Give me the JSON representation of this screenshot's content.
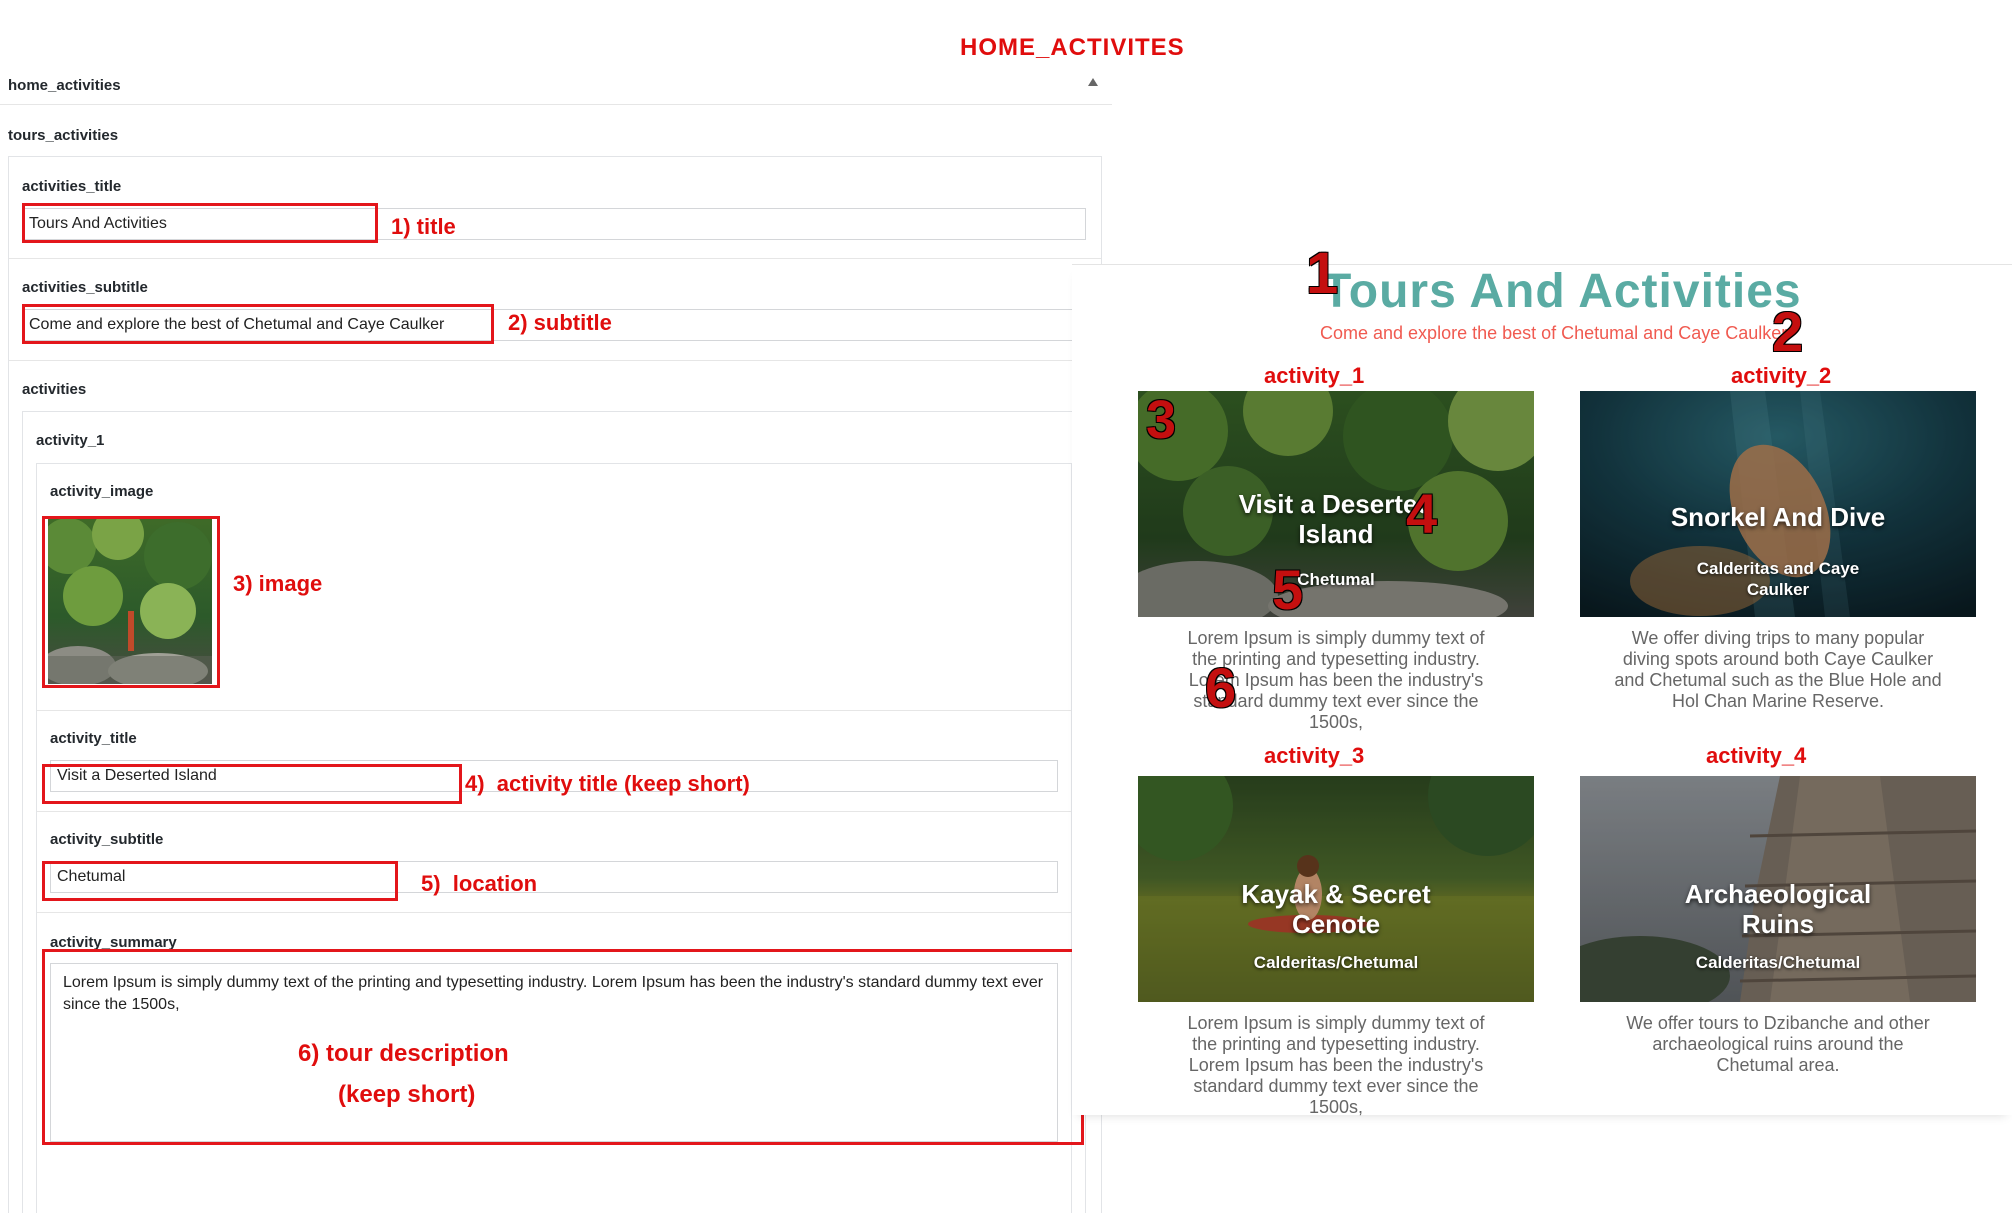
{
  "header": {
    "title": "HOME_ACTIVITES"
  },
  "admin": {
    "section_label": "home_activities",
    "collapse_icon": "triangle-up-icon",
    "group_label": "tours_activities",
    "activities_title_label": "activities_title",
    "activities_title_value": "Tours And Activities",
    "activities_subtitle_label": "activities_subtitle",
    "activities_subtitle_value": "Come and explore the best of Chetumal and Caye Caulker",
    "activities_label": "activities",
    "activity_1_label": "activity_1",
    "activity_image_label": "activity_image",
    "activity_title_label": "activity_title",
    "activity_title_value": "Visit a Deserted Island",
    "activity_subtitle_label": "activity_subtitle",
    "activity_subtitle_value": "Chetumal",
    "activity_summary_label": "activity_summary",
    "activity_summary_value": "Lorem Ipsum is simply dummy text of the printing and typesetting industry. Lorem Ipsum has been the industry's standard dummy text ever since the 1500s,"
  },
  "annotations": {
    "title": "1) title",
    "subtitle": "2) subtitle",
    "image": "3) image",
    "activity_title": "4)  activity title (keep short)",
    "location": "5)  location",
    "description_line1": "6) tour description",
    "description_line2": "(keep short)"
  },
  "preview": {
    "title": "Tours And Activities",
    "subtitle": "Come and explore the best of Chetumal and Caye Caulker",
    "markers": [
      "1",
      "2",
      "3",
      "4",
      "5",
      "6"
    ],
    "accent_color": "#5aaba3",
    "subtitle_color": "#f05a50",
    "cards": [
      {
        "label": "activity_1",
        "title": "Visit a Deserted Island",
        "location": "Chetumal",
        "description": "Lorem Ipsum is simply dummy text of the printing and typesetting industry. Lorem Ipsum has been the industry's standard dummy text ever since the 1500s,"
      },
      {
        "label": "activity_2",
        "title": "Snorkel And Dive",
        "location": "Calderitas and Caye Caulker",
        "description": "We offer diving trips to many popular diving spots around both Caye Caulker and Chetumal such as the Blue Hole and Hol Chan Marine Reserve."
      },
      {
        "label": "activity_3",
        "title": "Kayak & Secret Cenote",
        "location": "Calderitas/Chetumal",
        "description": "Lorem Ipsum is simply dummy text of the printing and typesetting industry. Lorem Ipsum has been the industry's standard dummy text ever since the 1500s,"
      },
      {
        "label": "activity_4",
        "title": "Archaeological Ruins",
        "location": "Calderitas/Chetumal",
        "description": "We offer tours to Dzibanche and other archaeological ruins around the Chetumal area."
      }
    ]
  }
}
